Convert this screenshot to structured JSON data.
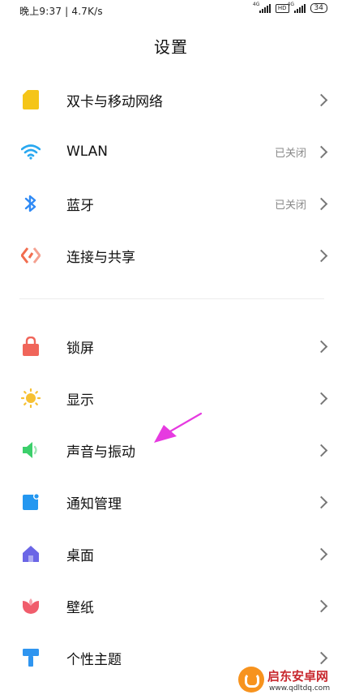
{
  "status_bar": {
    "time": "晚上9:37 | 4.7K/s",
    "signal1_tag": "4G",
    "hd_tag": "HD",
    "signal2_tag": "4G",
    "battery": "34"
  },
  "page": {
    "title": "设置"
  },
  "settings_items": [
    {
      "label": "双卡与移动网络",
      "value": "",
      "icon": "sim-card-icon",
      "color": "#f5c518"
    },
    {
      "label": "WLAN",
      "value": "已关闭",
      "icon": "wifi-icon",
      "color": "#29a8f0"
    },
    {
      "label": "蓝牙",
      "value": "已关闭",
      "icon": "bluetooth-icon",
      "color": "#2f8af5"
    },
    {
      "label": "连接与共享",
      "value": "",
      "icon": "share-connect-icon",
      "color": "#f16d4f"
    },
    {
      "label": "锁屏",
      "value": "",
      "icon": "lock-icon",
      "color": "#f0655a"
    },
    {
      "label": "显示",
      "value": "",
      "icon": "sun-icon",
      "color": "#f6c033"
    },
    {
      "label": "声音与振动",
      "value": "",
      "icon": "speaker-icon",
      "color": "#3ccf6b"
    },
    {
      "label": "通知管理",
      "value": "",
      "icon": "notification-icon",
      "color": "#2497f0"
    },
    {
      "label": "桌面",
      "value": "",
      "icon": "home-icon",
      "color": "#6b66e6"
    },
    {
      "label": "壁纸",
      "value": "",
      "icon": "flower-icon",
      "color": "#f05d6c"
    },
    {
      "label": "个性主题",
      "value": "",
      "icon": "theme-brush-icon",
      "color": "#2f95f0"
    }
  ],
  "watermark": {
    "name": "启东安卓网",
    "url": "www.qdltdq.com"
  },
  "annotation": {
    "arrow_color": "#e63ae0"
  }
}
